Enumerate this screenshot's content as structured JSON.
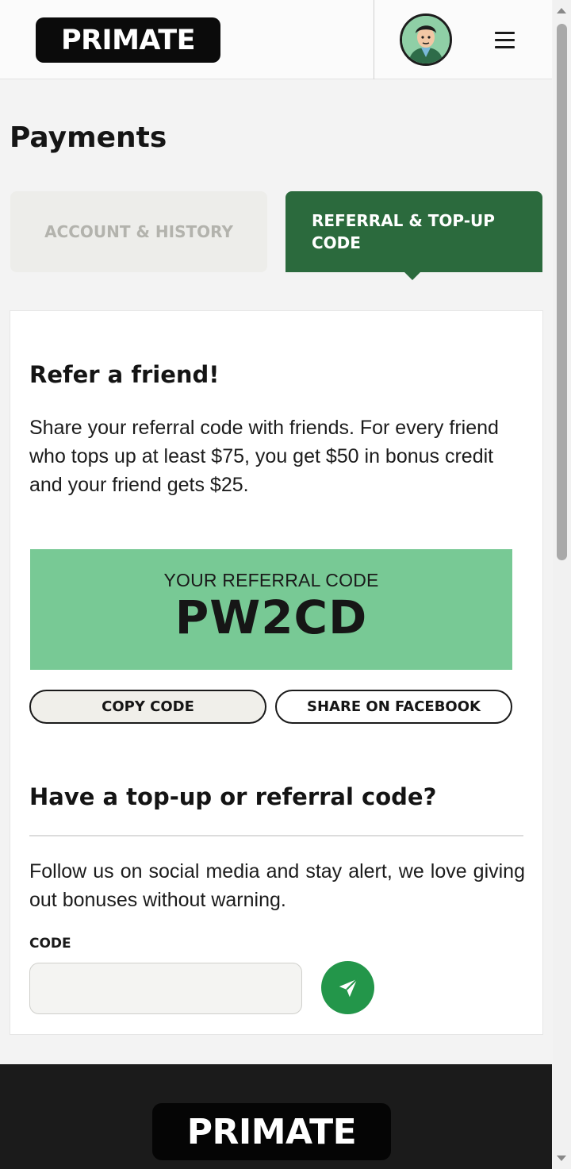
{
  "header": {
    "logo_text": "PRIMATE",
    "avatar_icon": "user-avatar-icon",
    "menu_icon": "hamburger-menu-icon"
  },
  "page": {
    "title": "Payments"
  },
  "tabs": [
    {
      "label": "ACCOUNT & HISTORY",
      "active": false
    },
    {
      "label": "REFERRAL & TOP-UP CODE",
      "active": true
    }
  ],
  "refer": {
    "heading": "Refer a friend!",
    "description": "Share your referral code with friends. For every friend who tops up at least $75, you get $50 in bonus credit and your friend gets $25.",
    "code_label": "YOUR REFERRAL CODE",
    "code_value": "PW2CD",
    "copy_button": "COPY CODE",
    "share_button": "SHARE ON FACEBOOK"
  },
  "topup": {
    "heading": "Have a top-up or referral code?",
    "description": "Follow us on social media and stay alert, we love giving out bonuses without warning.",
    "field_label": "CODE",
    "input_value": "",
    "send_icon": "send-plane-icon"
  },
  "footer": {
    "logo_text": "PRIMATE"
  },
  "colors": {
    "tab_active_bg": "#2b6a3d",
    "code_box_bg": "#78c995",
    "send_button_bg": "#23964a",
    "footer_bg": "#1b1b1b"
  }
}
